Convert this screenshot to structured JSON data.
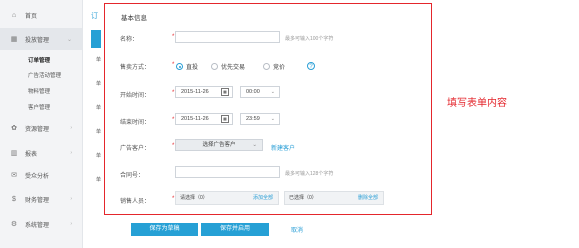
{
  "sidebar": {
    "items": [
      {
        "icon": "home-icon",
        "glyph": "⌂",
        "label": "首页"
      },
      {
        "icon": "grid-icon",
        "glyph": "▦",
        "label": "投放管理",
        "expanded": true
      },
      {
        "icon": "gear-icon",
        "glyph": "✿",
        "label": "资源管理"
      },
      {
        "icon": "bar-chart-icon",
        "glyph": "▥",
        "label": "报表"
      },
      {
        "icon": "message-icon",
        "glyph": "✉",
        "label": "受众分析"
      },
      {
        "icon": "dollar-icon",
        "glyph": "$",
        "label": "财务管理"
      },
      {
        "icon": "settings-icon",
        "glyph": "⚙",
        "label": "系统管理"
      }
    ],
    "subitems": [
      "订单管理",
      "广告活动管理",
      "物料管理",
      "客户管理"
    ]
  },
  "background": {
    "title": "订",
    "chars": [
      "单",
      "单",
      "单",
      "单",
      "单",
      "单"
    ]
  },
  "form": {
    "section_title": "基本信息",
    "name": {
      "label": "名称：",
      "hint": "最多可输入100个字符"
    },
    "sale_type": {
      "label": "售卖方式：",
      "options": [
        "直投",
        "优先交易",
        "竞价"
      ],
      "selected": "直投",
      "help": "?"
    },
    "start_time": {
      "label": "开始时间：",
      "date": "2015-11-26",
      "time": "00:00"
    },
    "end_time": {
      "label": "结束时间：",
      "date": "2015-11-26",
      "time": "23:59"
    },
    "client": {
      "label": "广告客户：",
      "select_label": "选择广告客户",
      "new_link": "新建客户"
    },
    "contract": {
      "label": "合同号：",
      "hint": "最多可输入128个字符"
    },
    "sales": {
      "label": "销售人员：",
      "left_label": "请选择（0）",
      "left_action": "添加全部",
      "right_label": "已选择（0）",
      "right_action": "删除全部"
    },
    "required_mark": "*",
    "calendar_glyph": "▦",
    "chevron": "⌄"
  },
  "annotation": "填写表单内容",
  "actions": {
    "save_draft": "保存为草稿",
    "save_enable": "保存并启用",
    "cancel": "取消"
  },
  "colors": {
    "accent": "#26a0d5",
    "highlight": "#e4262c"
  }
}
